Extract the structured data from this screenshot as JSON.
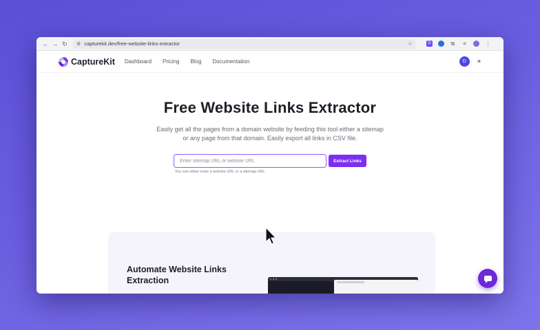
{
  "browser": {
    "url": "capturekit.dev/free-website-links-extractor",
    "extension_labels": [
      "D",
      "D"
    ]
  },
  "site_nav": {
    "brand": "CaptureKit",
    "links": [
      "Dashboard",
      "Pricing",
      "Blog",
      "Documentation"
    ],
    "avatar_initial": "D"
  },
  "hero": {
    "title": "Free Website Links Extractor",
    "description": "Easily get all the pages from a domain website by feeding this tool either a sitemap or any page from that domain. Easily export all links in CSV file.",
    "input_placeholder": "Enter sitemap URL or website URL",
    "button_label": "Extract Links",
    "hint": "You can either enter a website URL or a sitemap URL."
  },
  "section": {
    "title": "Automate Website Links Extraction"
  },
  "colors": {
    "accent": "#7c2ff0",
    "input_border": "#8b5cf6",
    "background": "#5b4fd6"
  },
  "icons": [
    "back-arrow-icon",
    "forward-arrow-icon",
    "reload-icon",
    "site-settings-icon",
    "star-icon",
    "extensions-icon",
    "theme-toggle-icon",
    "chat-icon",
    "mouse-cursor-icon"
  ]
}
